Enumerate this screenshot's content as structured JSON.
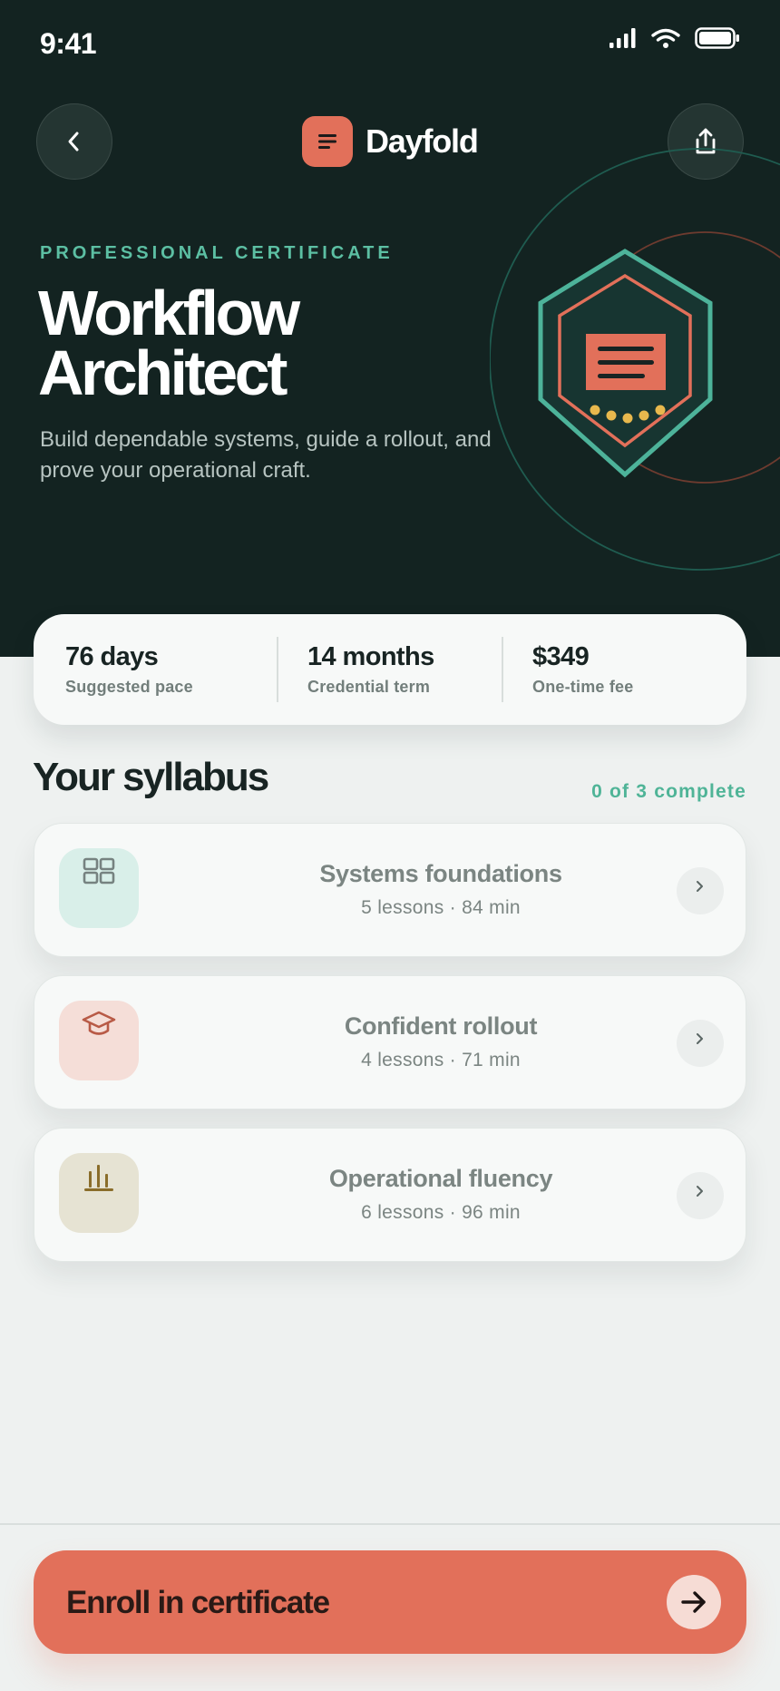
{
  "status_bar": {
    "time": "9:41"
  },
  "header": {
    "back_icon": "chevron-left-icon",
    "share_icon": "share-icon",
    "brand_name": "Dayfold",
    "brand_color": "#e2705a"
  },
  "hero": {
    "kicker": "PROFESSIONAL CERTIFICATE",
    "title": "Workflow Architect",
    "subtitle": "Build dependable systems, guide a rollout, and prove your operational craft.",
    "background": "#132321",
    "accent": "#5cbfa3"
  },
  "stats": [
    {
      "value": "76 days",
      "label": "Suggested pace"
    },
    {
      "value": "14 months",
      "label": "Credential term"
    },
    {
      "value": "$349",
      "label": "One-time fee"
    }
  ],
  "syllabus": {
    "title": "Your syllabus",
    "progress": "0 of 3 complete",
    "modules": [
      {
        "title": "Systems foundations",
        "meta": "5 lessons · 84 min",
        "icon": "grid-icon",
        "tile_color": "#d9efe9"
      },
      {
        "title": "Confident rollout",
        "meta": "4 lessons · 71 min",
        "icon": "graduation-cap-icon",
        "tile_color": "#f5ded8"
      },
      {
        "title": "Operational fluency",
        "meta": "6 lessons · 96 min",
        "icon": "bar-chart-icon",
        "tile_color": "#e6e3d3"
      }
    ]
  },
  "cta": {
    "label": "Enroll in certificate",
    "icon": "arrow-right-icon",
    "color": "#e2705a"
  }
}
